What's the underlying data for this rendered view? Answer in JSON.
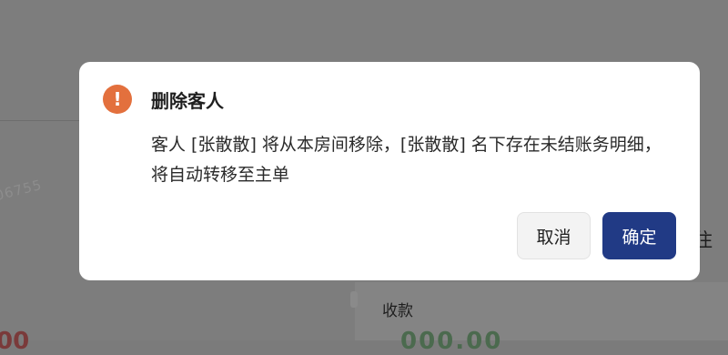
{
  "background": {
    "partial_number": "06755",
    "label": "收款",
    "right_char": "住",
    "left_amount": "00",
    "right_amount": "000.00"
  },
  "dialog": {
    "icon": "exclamation-icon",
    "icon_glyph": "!",
    "title": "删除客人",
    "message": "客人 [张散散] 将从本房间移除，[张散散] 名下存在未结账务明细，将自动转移至主单",
    "cancel_label": "取消",
    "confirm_label": "确定"
  },
  "colors": {
    "warning": "#e3703d",
    "primary": "#213a85"
  }
}
